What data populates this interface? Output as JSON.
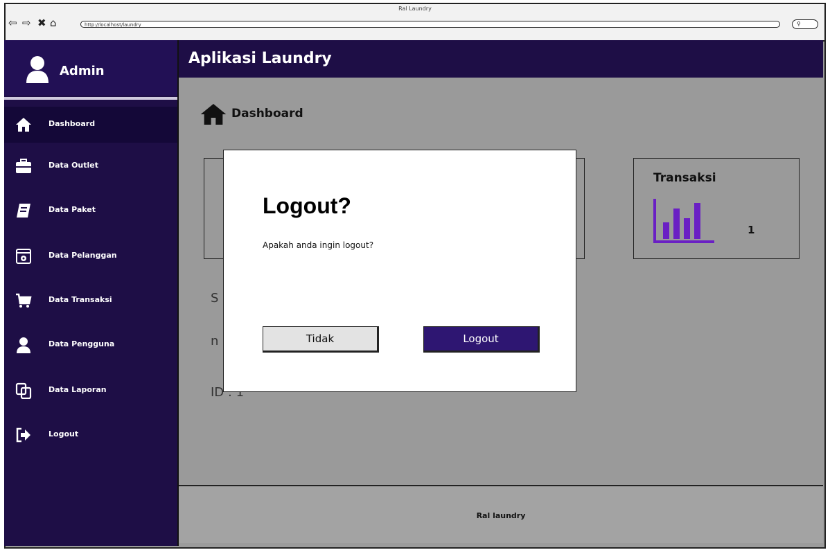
{
  "browser": {
    "title": "Ral Laundry",
    "url": "http://localhost/laundry"
  },
  "sidebar": {
    "user_name": "Admin",
    "items": [
      {
        "label": "Dashboard",
        "icon": "home-icon",
        "active": true
      },
      {
        "label": "Data Outlet",
        "icon": "briefcase-icon",
        "active": false
      },
      {
        "label": "Data Paket",
        "icon": "book-icon",
        "active": false
      },
      {
        "label": "Data Pelanggan",
        "icon": "archive-icon",
        "active": false
      },
      {
        "label": "Data Transaksi",
        "icon": "cart-icon",
        "active": false
      },
      {
        "label": "Data Pengguna",
        "icon": "user-icon",
        "active": false
      },
      {
        "label": "Data Laporan",
        "icon": "copy-icon",
        "active": false
      },
      {
        "label": "Logout",
        "icon": "logout-icon",
        "active": false
      }
    ]
  },
  "header": {
    "title": "Aplikasi Laundry"
  },
  "main": {
    "heading": "Dashboard",
    "transaksi_card": {
      "title": "Transaksi",
      "value": "1"
    },
    "partial_text": {
      "line1": "S",
      "line2": "n",
      "line3": "ID : 1"
    }
  },
  "footer": {
    "text": "Ral laundry"
  },
  "modal": {
    "title": "Logout?",
    "message": "Apakah anda ingin logout?",
    "cancel_label": "Tidak",
    "confirm_label": "Logout"
  },
  "colors": {
    "sidebar_bg": "#1e0e46",
    "accent": "#2e1672",
    "chart_icon": "#6a1fc4"
  }
}
